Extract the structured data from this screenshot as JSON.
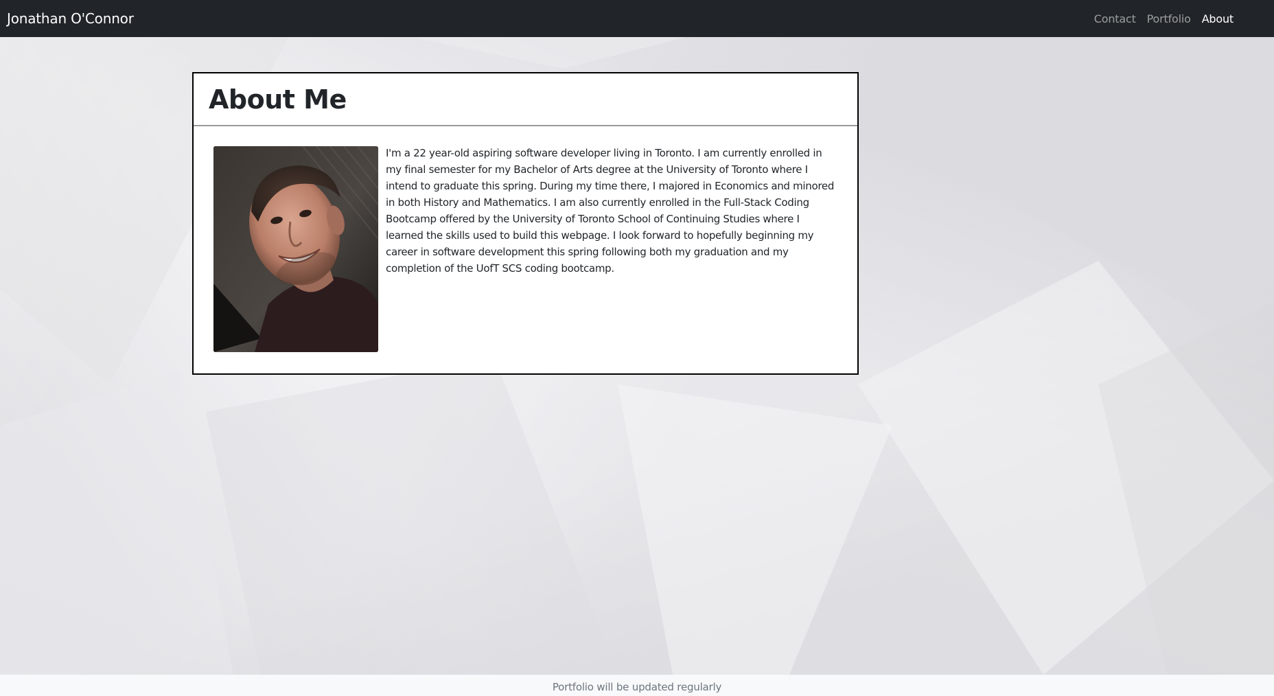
{
  "navbar": {
    "brand": "Jonathan O'Connor",
    "links": [
      {
        "label": "Contact",
        "active": false
      },
      {
        "label": "Portfolio",
        "active": false
      },
      {
        "label": "About",
        "active": true
      }
    ]
  },
  "about": {
    "title": "About Me",
    "bio": "I'm a 22 year-old aspiring software developer living in Toronto. I am currently enrolled in my final semester for my Bachelor of Arts degree at the University of Toronto where I intend to graduate this spring. During my time there, I majored in Economics and minored in both History and Mathematics. I am also currently enrolled in the Full-Stack Coding Bootcamp offered by the University of Toronto School of Continuing Studies where I learned the skills used to build this webpage. I look forward to hopefully beginning my career in software development this spring following both my graduation and my completion of the UofT SCS coding bootcamp."
  },
  "footer": {
    "text": "Portfolio will be updated regularly"
  },
  "colors": {
    "navbar_bg": "#212529",
    "nav_active": "#ffffff",
    "nav_inactive": "rgba(255,255,255,0.55)",
    "card_border": "#000000",
    "footer_bg": "#f8f9fa",
    "footer_text": "#6c757d"
  }
}
